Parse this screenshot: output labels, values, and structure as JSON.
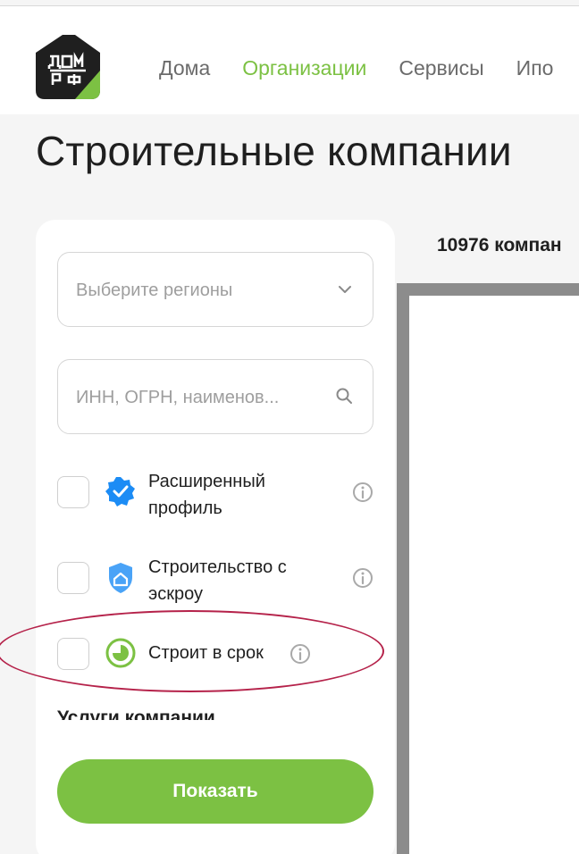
{
  "header": {
    "logo_text_top": "ДОМ",
    "logo_text_bottom": "РФ",
    "nav": [
      {
        "label": "Дома",
        "active": false
      },
      {
        "label": "Организации",
        "active": true
      },
      {
        "label": "Сервисы",
        "active": false
      },
      {
        "label": "Ипо",
        "active": false
      }
    ]
  },
  "page": {
    "title": "Строительные компании",
    "result_count": "10976 компан"
  },
  "filters": {
    "region_placeholder": "Выберите регионы",
    "search_placeholder": "ИНН, ОГРН, наименов...",
    "checkboxes": [
      {
        "label_line1": "Расширенный",
        "label_line2": "профиль",
        "icon": "verified-badge-icon"
      },
      {
        "label_line1": "Строительство с",
        "label_line2": "эскроу",
        "icon": "escrow-shield-icon"
      },
      {
        "label_line1": "Строит в срок",
        "label_line2": "",
        "icon": "on-time-clock-icon"
      }
    ],
    "section_heading": "Услуги компании",
    "submit_label": "Показать"
  },
  "colors": {
    "accent_green": "#7cc143",
    "verified_blue": "#1c8cf5",
    "highlight_red": "#b5224a"
  }
}
